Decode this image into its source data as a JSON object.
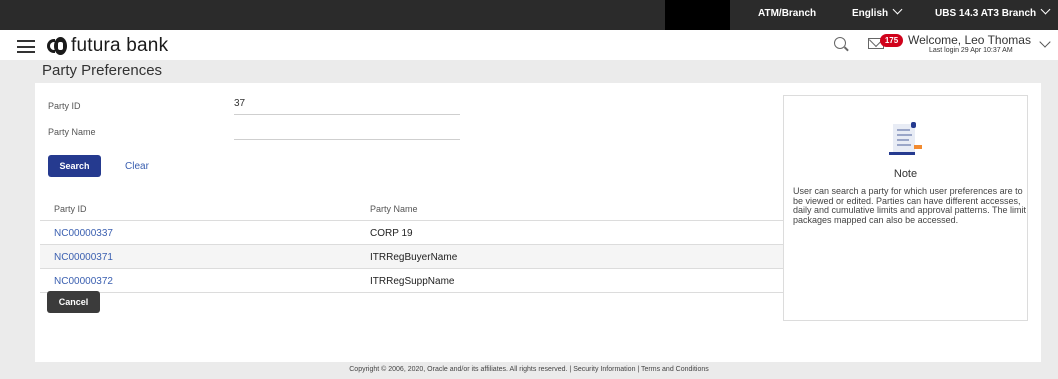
{
  "topbar": {
    "atm_branch": "ATM/Branch",
    "language": "English",
    "branch": "UBS 14.3 AT3 Branch"
  },
  "header": {
    "brand": "futura bank",
    "notification_count": "175",
    "welcome": "Welcome, Leo Thomas",
    "last_login": "Last login 29 Apr 10:37 AM"
  },
  "page": {
    "title": "Party Preferences"
  },
  "form": {
    "party_id_label": "Party ID",
    "party_id_value": "37",
    "party_name_label": "Party Name",
    "party_name_value": "",
    "search_label": "Search",
    "clear_label": "Clear"
  },
  "results": {
    "headers": [
      "Party ID",
      "Party Name"
    ],
    "rows": [
      {
        "id": "NC00000337",
        "name": "CORP 19"
      },
      {
        "id": "NC00000371",
        "name": "ITRRegBuyerName"
      },
      {
        "id": "NC00000372",
        "name": "ITRRegSuppName"
      }
    ],
    "cancel_label": "Cancel"
  },
  "note": {
    "title": "Note",
    "text": "User can search a party for which user preferences are to be viewed or edited. Parties can have different accesses, daily and cumulative limits and approval patterns. The limit packages mapped can also be accessed."
  },
  "footer": {
    "text": "Copyright © 2006, 2020, Oracle and/or its affiliates. All rights reserved. | Security Information | Terms and Conditions"
  },
  "colors": {
    "topbar": "#2b2b2b",
    "primary_button": "#253a8f",
    "link": "#3a5fb0",
    "badge": "#d0021b",
    "secondary_button": "#3b3b3b"
  }
}
